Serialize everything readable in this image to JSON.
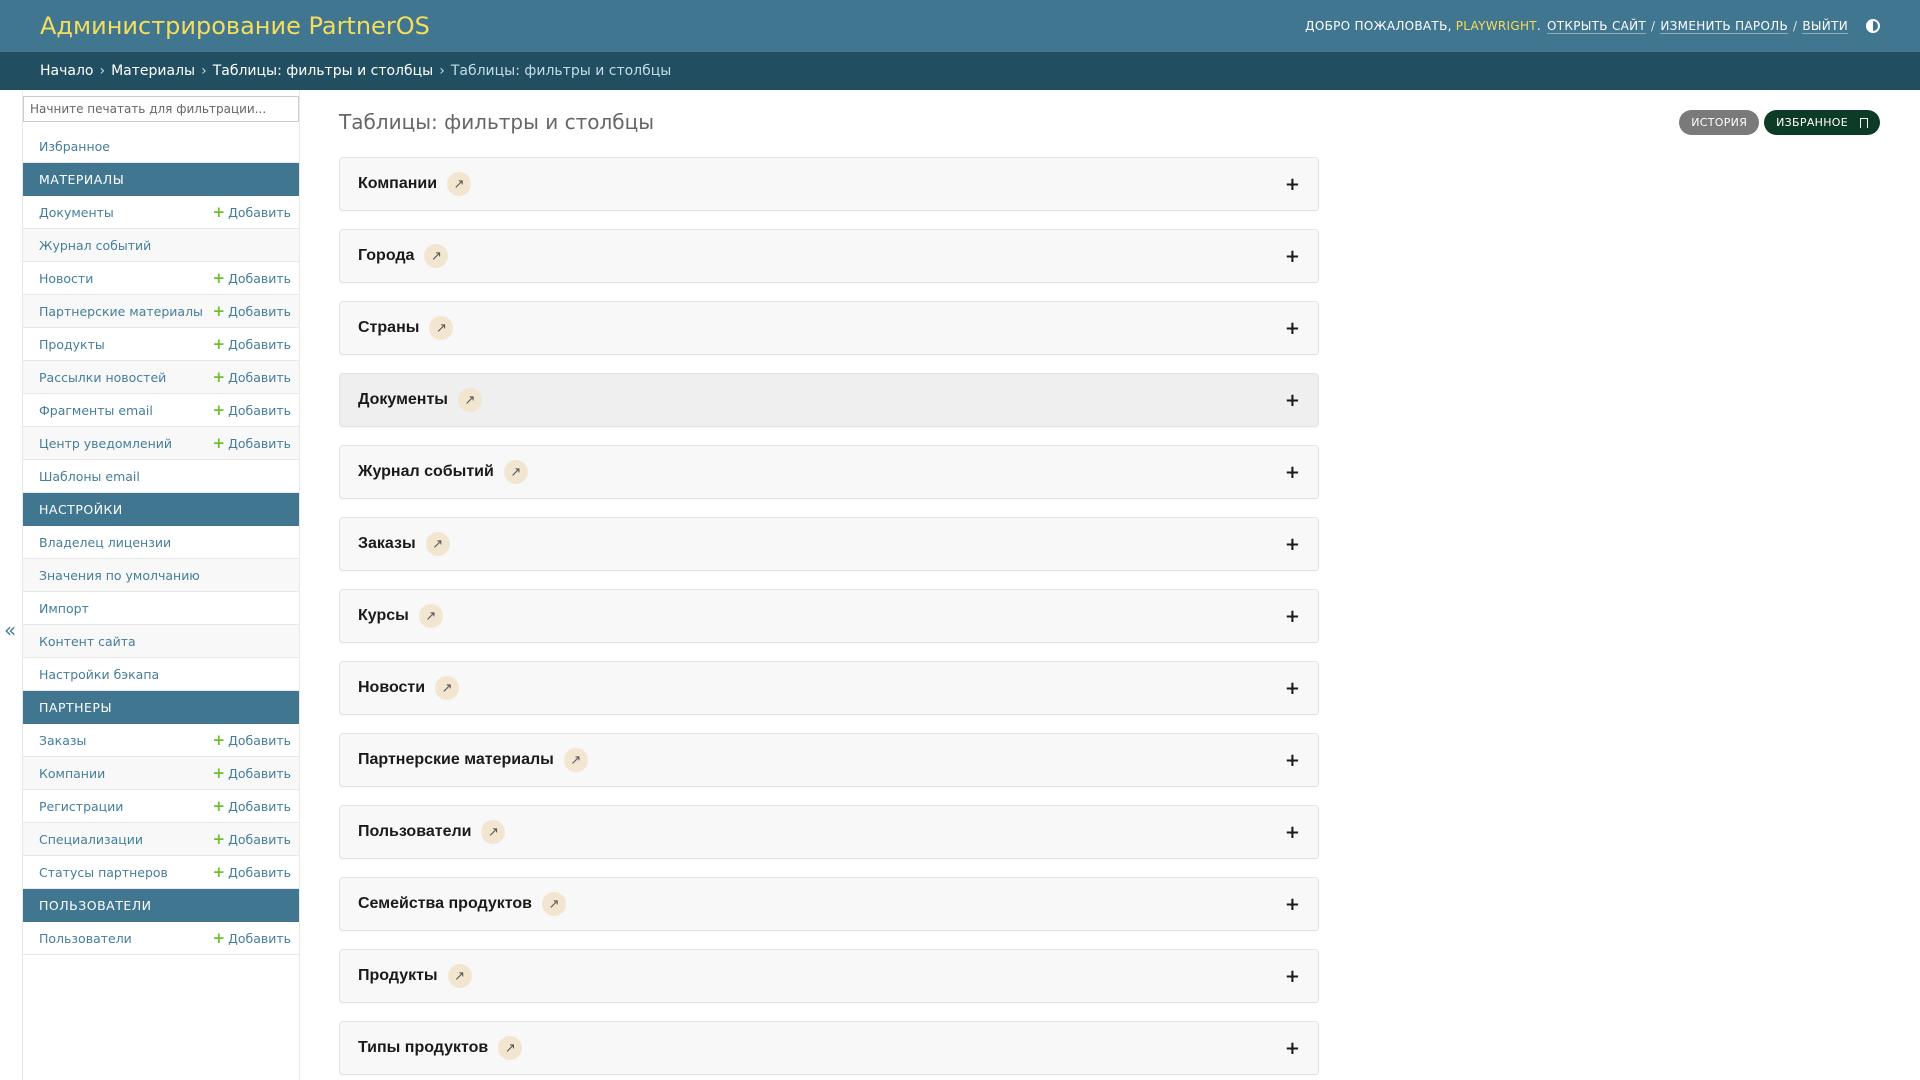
{
  "header": {
    "brand": "Администрирование PartnerOS",
    "welcome": "Добро пожаловать,",
    "username": "playwright",
    "links": [
      "Открыть сайт",
      "Изменить пароль",
      "Выйти"
    ]
  },
  "breadcrumbs": {
    "items": [
      "Начало",
      "Материалы",
      "Таблицы: фильтры и столбцы"
    ],
    "current": "Таблицы: фильтры и столбцы"
  },
  "sidebar": {
    "filter_placeholder": "Начните печатать для фильтрации...",
    "favorites": "Избранное",
    "add_label": "Добавить",
    "sections": [
      {
        "title": "Материалы",
        "items": [
          {
            "label": "Документы",
            "add": true
          },
          {
            "label": "Журнал событий",
            "add": false
          },
          {
            "label": "Новости",
            "add": true
          },
          {
            "label": "Партнерские материалы",
            "add": true
          },
          {
            "label": "Продукты",
            "add": true
          },
          {
            "label": "Рассылки новостей",
            "add": true
          },
          {
            "label": "Фрагменты email",
            "add": true
          },
          {
            "label": "Центр уведомлений",
            "add": true
          },
          {
            "label": "Шаблоны email",
            "add": false
          }
        ]
      },
      {
        "title": "Настройки",
        "items": [
          {
            "label": "Владелец лицензии",
            "add": false
          },
          {
            "label": "Значения по умолчанию",
            "add": false
          },
          {
            "label": "Импорт",
            "add": false
          },
          {
            "label": "Контент сайта",
            "add": false
          },
          {
            "label": "Настройки бэкапа",
            "add": false
          }
        ]
      },
      {
        "title": "Партнеры",
        "items": [
          {
            "label": "Заказы",
            "add": true
          },
          {
            "label": "Компании",
            "add": true
          },
          {
            "label": "Регистрации",
            "add": true
          },
          {
            "label": "Специализации",
            "add": true
          },
          {
            "label": "Статусы партнеров",
            "add": true
          }
        ]
      },
      {
        "title": "Пользователи",
        "items": [
          {
            "label": "Пользователи",
            "add": true
          }
        ]
      }
    ],
    "collapse_glyph": "«"
  },
  "main": {
    "title": "Таблицы: фильтры и столбцы",
    "tools": {
      "history": "История",
      "favorite": "Избранное"
    },
    "modules": [
      "Компании",
      "Города",
      "Страны",
      "Документы",
      "Журнал событий",
      "Заказы",
      "Курсы",
      "Новости",
      "Партнерские материалы",
      "Пользователи",
      "Семейства продуктов",
      "Продукты",
      "Типы продуктов"
    ],
    "hovered_module_index": 3
  },
  "colors": {
    "header_bg": "#417690",
    "brand": "#f5dd5d",
    "breadcrumbs_bg": "#214f61",
    "section_bg": "#417690",
    "link": "#447e9b",
    "add_plus": "#70bf2b",
    "favorite_btn": "#0c3c26",
    "history_btn": "#7a7a7a"
  },
  "icons": {
    "module_open": "arrow-up-right-icon",
    "module_expand": "plus-icon",
    "theme": "contrast-icon",
    "bookmark": "bookmark-icon"
  }
}
